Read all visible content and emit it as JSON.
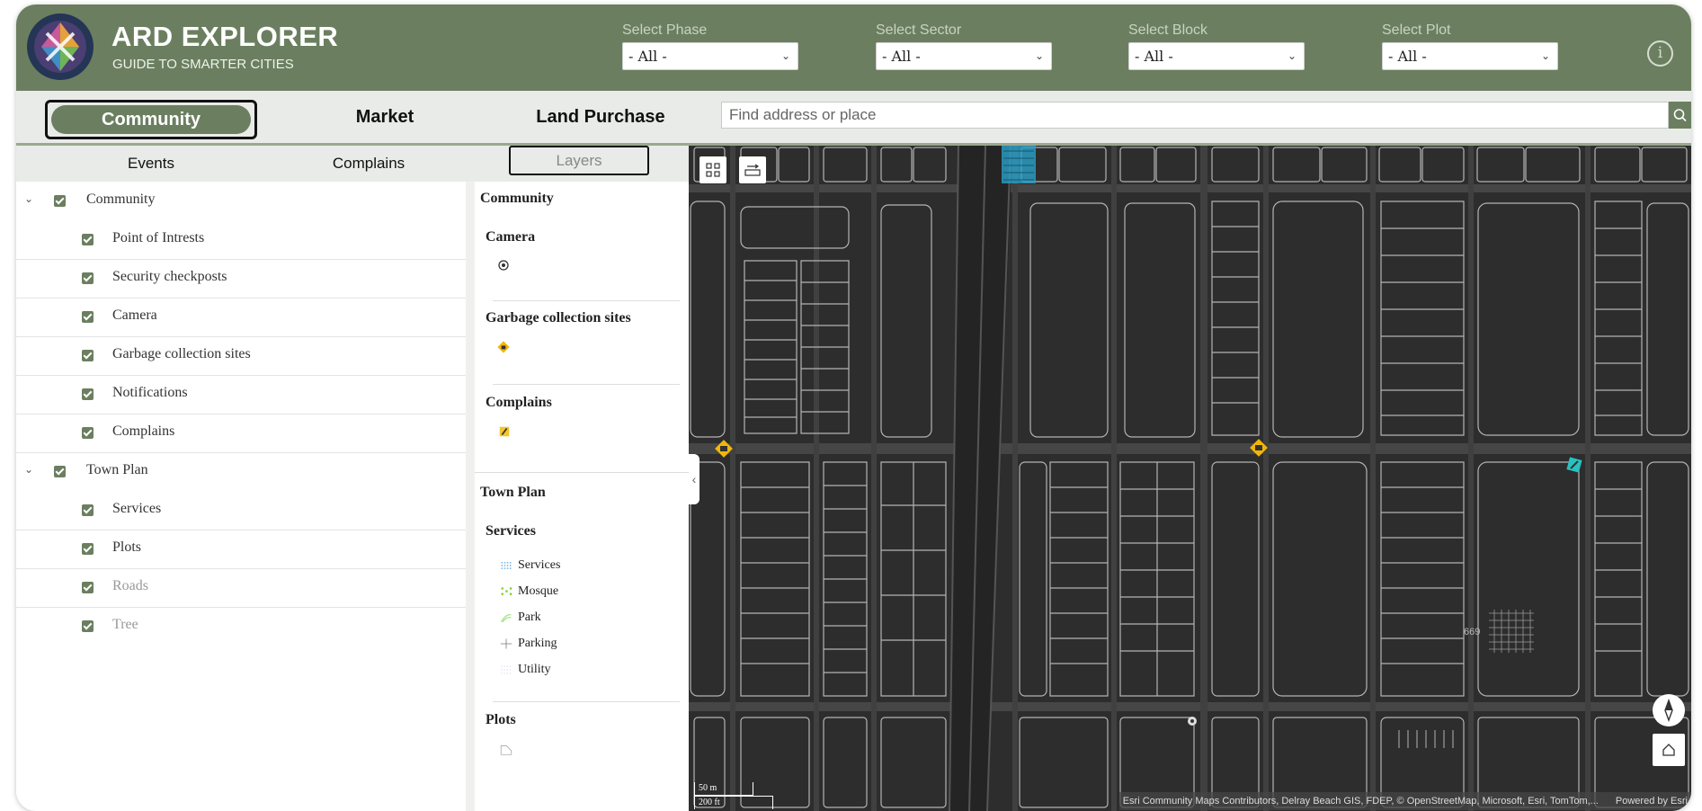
{
  "header": {
    "app_title": "ARD EXPLORER",
    "app_subtitle": "GUIDE TO SMARTER CITIES",
    "filters": [
      {
        "label": "Select Phase",
        "value": "- All -"
      },
      {
        "label": "Select Sector",
        "value": "- All -"
      },
      {
        "label": "Select Block",
        "value": "- All -"
      },
      {
        "label": "Select Plot",
        "value": "- All -"
      }
    ],
    "info_icon": "info-icon"
  },
  "nav": {
    "tabs": [
      "Community",
      "Market",
      "Land Purchase"
    ],
    "active": "Community",
    "search_placeholder": "Find address or place"
  },
  "subtabs": {
    "items": [
      "Events",
      "Complains",
      "Layers"
    ],
    "active": "Layers"
  },
  "layers": {
    "groups": [
      {
        "label": "Community",
        "items": [
          "Point of Intrests",
          "Security checkposts",
          "Camera",
          "Garbage collection sites",
          "Notifications",
          "Complains"
        ]
      },
      {
        "label": "Town Plan",
        "items": [
          "Services",
          "Plots",
          "Roads",
          "Tree"
        ]
      }
    ]
  },
  "legend": {
    "community_heading": "Community",
    "camera": "Camera",
    "garbage": "Garbage collection sites",
    "complains": "Complains",
    "townplan_heading": "Town Plan",
    "services_heading": "Services",
    "services_items": [
      "Services",
      "Mosque",
      "Park",
      "Parking",
      "Utility"
    ],
    "plots": "Plots"
  },
  "map": {
    "plot_label": "669",
    "scale_m": "50 m",
    "scale_ft": "200 ft",
    "attribution": "Esri Community Maps Contributors, Delray Beach GIS, FDEP, © OpenStreetMap, Microsoft, Esri, TomTom,...",
    "powered_by": "Powered by Esri"
  },
  "colors": {
    "header_green": "#6b7f60",
    "map_bg": "#2d2d2d",
    "road": "#444444",
    "parcel_stroke": "#b4b4b4"
  }
}
